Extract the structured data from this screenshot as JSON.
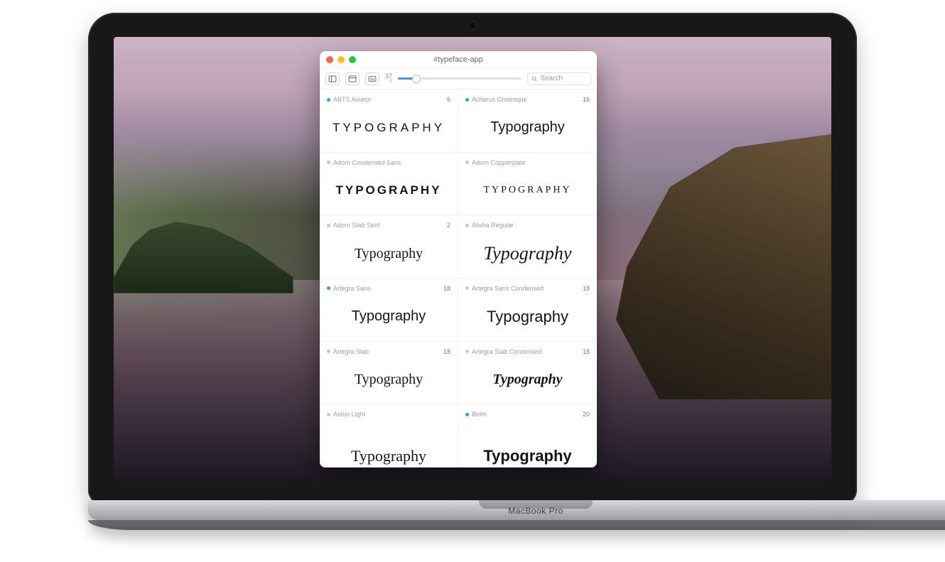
{
  "device_label": "MacBook Pro",
  "window": {
    "title": "#typeface-app",
    "toolbar": {
      "size_value": "37",
      "size_min": "0",
      "slider_percent": 15,
      "search_placeholder": "Search"
    }
  },
  "preview_word": "Typography",
  "fonts": [
    {
      "name": "ABTS Aviator",
      "count": "6",
      "tag": "blue",
      "style": "f-caps1",
      "caps": true
    },
    {
      "name": "Acherus Grotesque",
      "count": "16",
      "tag": "blue",
      "style": "f-geo",
      "caps": false
    },
    {
      "name": "Adorn Condensed Sans",
      "count": "",
      "tag": "grey",
      "style": "f-caps2",
      "caps": true
    },
    {
      "name": "Adorn Copperplate",
      "count": "",
      "tag": "grey",
      "style": "f-copper",
      "caps": true
    },
    {
      "name": "Adorn Slab Serif",
      "count": "2",
      "tag": "grey",
      "style": "f-slab",
      "caps": false
    },
    {
      "name": "Alisha Regular",
      "count": "",
      "tag": "grey",
      "style": "f-script",
      "caps": false
    },
    {
      "name": "Artegra Sans",
      "count": "18",
      "tag": "blue",
      "style": "f-sans",
      "caps": false
    },
    {
      "name": "Artegra Sans Condensed",
      "count": "18",
      "tag": "grey",
      "style": "f-cond",
      "caps": false
    },
    {
      "name": "Artegra Slab",
      "count": "18",
      "tag": "grey",
      "style": "f-slab2",
      "caps": false
    },
    {
      "name": "Artegra Slab Condensed",
      "count": "18",
      "tag": "grey",
      "style": "f-slabit",
      "caps": false
    },
    {
      "name": "Aston Light",
      "count": "",
      "tag": "grey",
      "style": "f-didot",
      "caps": false
    },
    {
      "name": "Betm",
      "count": "20",
      "tag": "blue",
      "style": "f-bold",
      "caps": false
    }
  ]
}
